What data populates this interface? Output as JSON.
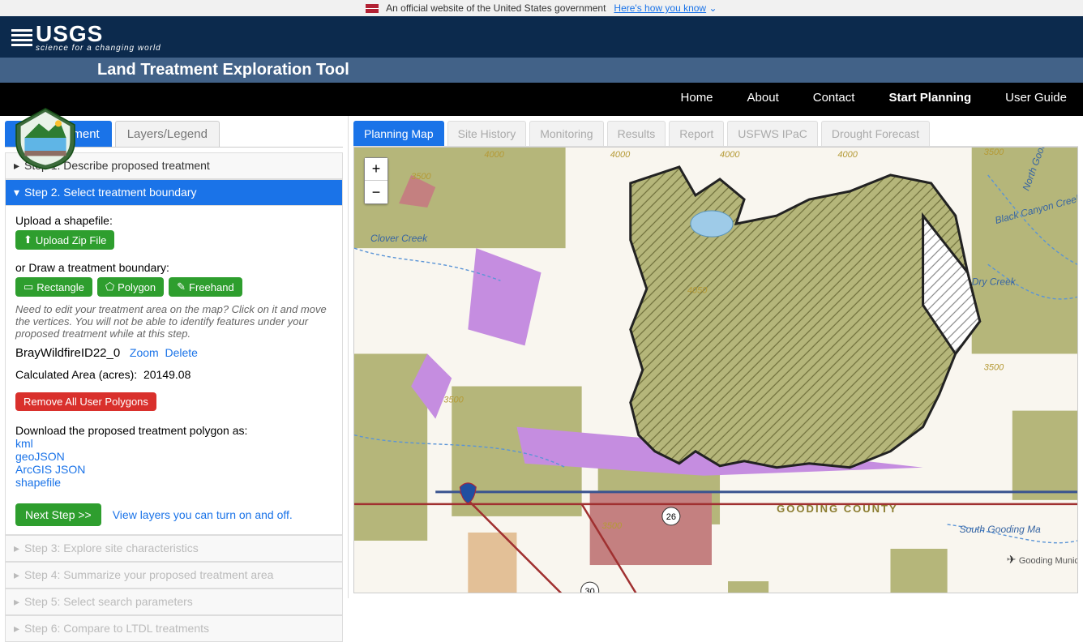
{
  "gov_banner": {
    "text": "An official website of the United States government",
    "link_text": "Here's how you know"
  },
  "usgs": {
    "name": "USGS",
    "tagline": "science for a changing world"
  },
  "tool_title": "Land Treatment Exploration Tool",
  "nav": {
    "items": [
      "Home",
      "About",
      "Contact",
      "Start Planning",
      "User Guide"
    ],
    "active": "Start Planning"
  },
  "sidebar": {
    "tabs": {
      "plan": "Plan Treatment",
      "layers": "Layers/Legend"
    },
    "steps": {
      "s1": "Step 1: Describe proposed treatment",
      "s2": "Step 2. Select treatment boundary",
      "s3": "Step 3: Explore site characteristics",
      "s4": "Step 4: Summarize your proposed treatment area",
      "s5": "Step 5: Select search parameters",
      "s6": "Step 6: Compare to LTDL treatments"
    },
    "upload_label": "Upload a shapefile:",
    "upload_btn": "Upload Zip File",
    "draw_label": "or Draw a treatment boundary:",
    "draw_btns": {
      "rect": "Rectangle",
      "poly": "Polygon",
      "free": "Freehand"
    },
    "edit_hint": "Need to edit your treatment area on the map? Click on it and move the vertices. You will not be able to identify features under your proposed treatment while at this step.",
    "polygon_name": "BrayWildfireID22_0",
    "zoom_link": "Zoom",
    "delete_link": "Delete",
    "area_label": "Calculated Area (acres):",
    "area_value": "20149.08",
    "remove_btn": "Remove All User Polygons",
    "download_label": "Download the proposed treatment polygon as:",
    "downloads": [
      "kml",
      "geoJSON",
      "ArcGIS JSON",
      "shapefile"
    ],
    "next_btn": "Next Step >>",
    "view_layers_link": "View layers you can turn on and off."
  },
  "content_tabs": {
    "items": [
      "Planning Map",
      "Site History",
      "Monitoring",
      "Results",
      "Report",
      "USFWS IPaC",
      "Drought Forecast"
    ],
    "active": "Planning Map"
  },
  "map": {
    "zoom_in": "+",
    "zoom_out": "−",
    "county_label": "GOODING COUNTY",
    "creeks": {
      "clover": "Clover Creek",
      "black": "Black Canyon Creek",
      "ngood": "North Gooding M",
      "dry": "Dry Creek",
      "sgood": "South Gooding Ma"
    },
    "airport": "Gooding Municipal Airp",
    "routes": {
      "r26": "26",
      "r30": "30"
    },
    "contours": [
      "4000",
      "4000",
      "4000",
      "4000",
      "3500",
      "3500",
      "3500",
      "4050",
      "3500",
      "3500"
    ]
  }
}
